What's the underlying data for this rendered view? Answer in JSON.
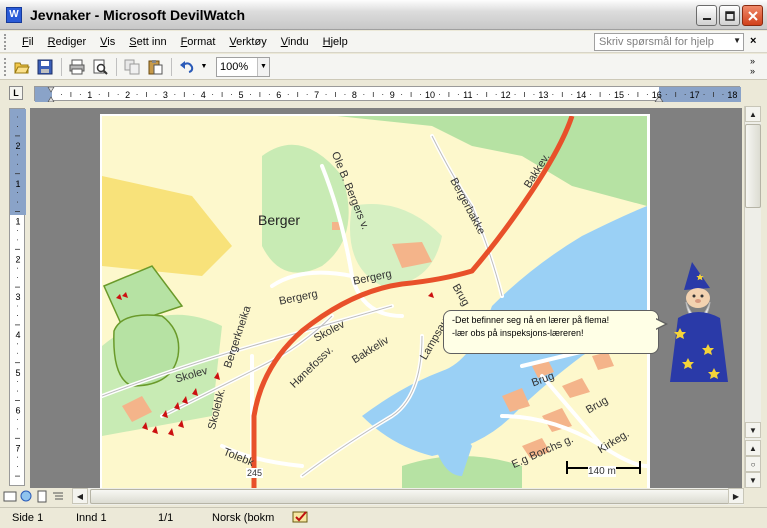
{
  "window": {
    "title": "Jevnaker - Microsoft DevilWatch",
    "app_icon": "W",
    "min_icon": "minimize-icon",
    "max_icon": "maximize-icon",
    "close_icon": "close-icon"
  },
  "menu": {
    "items": [
      "Fil",
      "Rediger",
      "Vis",
      "Sett inn",
      "Format",
      "Verktøy",
      "Vindu",
      "Hjelp"
    ],
    "help_placeholder": "Skriv spørsmål for hjelp"
  },
  "toolbar": {
    "icons": [
      "open-folder-icon",
      "save-icon",
      "print-icon",
      "print-preview-icon",
      "copy-icon",
      "paste-icon",
      "undo-icon"
    ],
    "zoom": "100%"
  },
  "ruler": {
    "h_marks": [
      "1",
      "2",
      "3",
      "4",
      "5",
      "6",
      "7",
      "8",
      "9",
      "10",
      "11",
      "12",
      "13",
      "14",
      "15",
      "16",
      "17",
      "18"
    ],
    "v_marks": [
      "2",
      "1",
      "1",
      "2",
      "3",
      "4",
      "5",
      "6",
      "7"
    ]
  },
  "map": {
    "labels": {
      "berger": "Berger",
      "ole_b_bergers_v": "Ole B. Bergers v.",
      "bergerbakke": "Bergerbakke",
      "bakke": "Bakkev.",
      "bergerg_1": "Bergerg",
      "bergerg_2": "Bergerg",
      "bergerkneika": "Bergerkneika",
      "skolev_1": "Skolev",
      "skolev_2": "Skolev",
      "hønefossv": "Hønefossv.",
      "bakkeliv": "Bakkeliv",
      "brug_1": "Brug",
      "brug_2": "Brug",
      "brug_3": "Brug",
      "lampsauv": "Lampsauv",
      "skolebk": "Skolebk.",
      "tolebk": "Tolebk",
      "e_g_borchs_g": "E.g Borchs g.",
      "kirkeg": "Kirkeg.",
      "road_number": "245"
    },
    "scale_label": "140 m",
    "colors": {
      "background": "#fdf8cc",
      "water": "#9ad0f5",
      "forest": "#b6e2a3",
      "field": "#f8e27a",
      "main_road": "#e8502a",
      "building": "#f4b48a",
      "marker": "#cc1010"
    }
  },
  "assistant": {
    "line1": "-Det befinner seg nå en lærer på flema!",
    "line2": "-lær obs på inspeksjons-læreren!",
    "icon": "wizard-assistant-icon"
  },
  "status": {
    "side": "Side  1",
    "innd": "Innd  1",
    "pages": "1/1",
    "language": "Norsk (bokm",
    "spell_icon": "spellcheck-book-icon"
  }
}
